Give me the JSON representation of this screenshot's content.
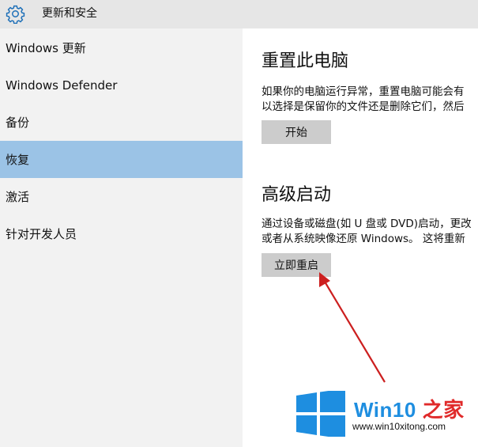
{
  "titlebar": {
    "title": "更新和安全",
    "icon": "gear-icon"
  },
  "sidebar": {
    "items": [
      {
        "label": "Windows 更新"
      },
      {
        "label": "Windows Defender"
      },
      {
        "label": "备份"
      },
      {
        "label": "恢复",
        "selected": true
      },
      {
        "label": "激活"
      },
      {
        "label": "针对开发人员"
      }
    ]
  },
  "main": {
    "reset": {
      "heading": "重置此电脑",
      "desc_line1": "如果你的电脑运行异常，重置电脑可能会有",
      "desc_line2": "以选择是保留你的文件还是删除它们，然后",
      "button": "开始"
    },
    "advanced": {
      "heading": "高级启动",
      "desc_line1": "通过设备或磁盘(如 U 盘或 DVD)启动，更改",
      "desc_line2": "或者从系统映像还原 Windows。 这将重新",
      "button": "立即重启"
    }
  },
  "watermark": {
    "brand_win": "Win10",
    "brand_rest": " 之家",
    "url": "www.win10xitong.com",
    "colors": {
      "win_blue": "#1e8ee0",
      "accent_red": "#e02a2a"
    }
  },
  "annotation": {
    "arrow_color": "#cc1f1f"
  }
}
